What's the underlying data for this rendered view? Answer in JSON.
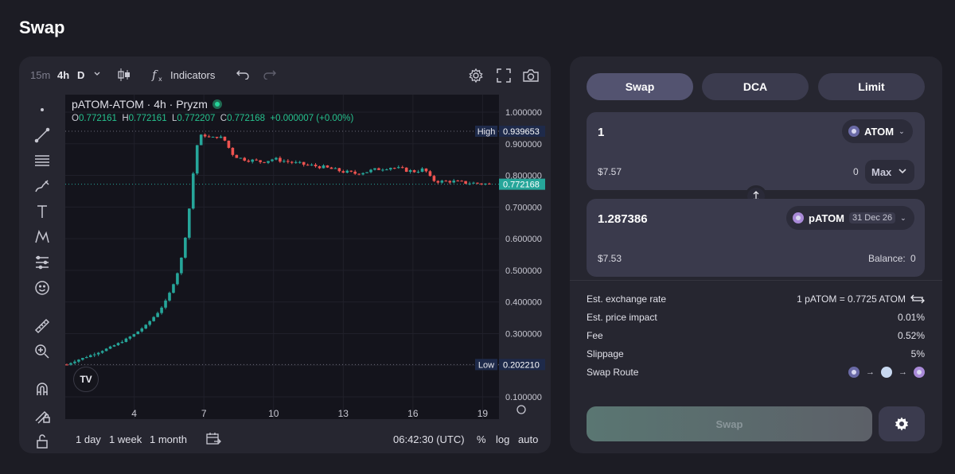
{
  "page": {
    "title": "Swap"
  },
  "chart_toolbar": {
    "interval_15m": "15m",
    "interval_4h": "4h",
    "interval_d": "D",
    "indicators_label": "Indicators"
  },
  "chart_bottom": {
    "range_1d": "1 day",
    "range_1w": "1 week",
    "range_1m": "1 month",
    "clock": "06:42:30 (UTC)",
    "percent_label": "%",
    "log_label": "log",
    "auto_label": "auto"
  },
  "chart_data": {
    "type": "candlestick",
    "title": "pATOM-ATOM · 4h · Pryzm",
    "ohlc_legend": {
      "o": "0.772161",
      "h": "0.772161",
      "l": "0.772207",
      "c": "0.772168",
      "change": "+0.000007 (+0.00%)"
    },
    "y_ticks": [
      "1.000000",
      "0.900000",
      "0.800000",
      "0.700000",
      "0.600000",
      "0.500000",
      "0.400000",
      "0.300000",
      "0.200000",
      "0.100000"
    ],
    "x_ticks": [
      {
        "day": 4,
        "label": "4"
      },
      {
        "day": 7,
        "label": "7"
      },
      {
        "day": 10,
        "label": "10"
      },
      {
        "day": 13,
        "label": "13"
      },
      {
        "day": 16,
        "label": "16"
      },
      {
        "day": 19,
        "label": "19"
      }
    ],
    "ylim": [
      0.1,
      1.0
    ],
    "xlim": [
      1.1,
      19.5
    ],
    "high": {
      "label": "High",
      "value": 0.939653,
      "text": "0.939653"
    },
    "low": {
      "label": "Low",
      "value": 0.20221,
      "text": "0.202210"
    },
    "last_price": {
      "value": 0.772168,
      "text": "0.772168"
    },
    "ohlc_points": [
      [
        1.1,
        0.202
      ],
      [
        1.5,
        0.215
      ],
      [
        2.0,
        0.228
      ],
      [
        2.5,
        0.242
      ],
      [
        3.0,
        0.258
      ],
      [
        3.5,
        0.276
      ],
      [
        4.0,
        0.298
      ],
      [
        4.5,
        0.326
      ],
      [
        5.0,
        0.365
      ],
      [
        5.3,
        0.395
      ],
      [
        5.6,
        0.44
      ],
      [
        5.9,
        0.5
      ],
      [
        6.1,
        0.56
      ],
      [
        6.3,
        0.65
      ],
      [
        6.5,
        0.78
      ],
      [
        6.65,
        0.88
      ],
      [
        6.8,
        0.92
      ],
      [
        7.0,
        0.93
      ],
      [
        7.3,
        0.915
      ],
      [
        7.6,
        0.925
      ],
      [
        7.9,
        0.91
      ],
      [
        8.2,
        0.87
      ],
      [
        8.5,
        0.855
      ],
      [
        9.0,
        0.848
      ],
      [
        9.5,
        0.843
      ],
      [
        10.0,
        0.852
      ],
      [
        10.5,
        0.845
      ],
      [
        11.0,
        0.838
      ],
      [
        11.5,
        0.832
      ],
      [
        12.0,
        0.828
      ],
      [
        12.5,
        0.82
      ],
      [
        13.0,
        0.812
      ],
      [
        13.5,
        0.806
      ],
      [
        14.0,
        0.812
      ],
      [
        14.5,
        0.82
      ],
      [
        15.0,
        0.826
      ],
      [
        15.5,
        0.82
      ],
      [
        16.0,
        0.812
      ],
      [
        16.5,
        0.82
      ],
      [
        16.8,
        0.786
      ],
      [
        17.2,
        0.78
      ],
      [
        17.6,
        0.782
      ],
      [
        18.0,
        0.778
      ],
      [
        18.5,
        0.776
      ],
      [
        19.0,
        0.774
      ],
      [
        19.3,
        0.772
      ]
    ]
  },
  "swap_panel": {
    "tabs": [
      "Swap",
      "DCA",
      "Limit"
    ],
    "from": {
      "amount": "1",
      "token": "ATOM",
      "usd": "$7.57",
      "balance": "0",
      "max_label": "Max"
    },
    "to": {
      "amount": "1.287386",
      "token": "pATOM",
      "maturity": "31 Dec 26",
      "usd": "$7.53",
      "balance_label": "Balance:",
      "balance": "0"
    },
    "info": {
      "rate_label": "Est. exchange rate",
      "rate_value": "1 pATOM = 0.7725 ATOM",
      "impact_label": "Est. price impact",
      "impact_value": "0.01%",
      "fee_label": "Fee",
      "fee_value": "0.52%",
      "slippage_label": "Slippage",
      "slippage_value": "5%",
      "route_label": "Swap Route"
    },
    "swap_button": "Swap"
  },
  "colors": {
    "up": "#26a69a",
    "down": "#ef5350",
    "accent": "#26d49a"
  }
}
